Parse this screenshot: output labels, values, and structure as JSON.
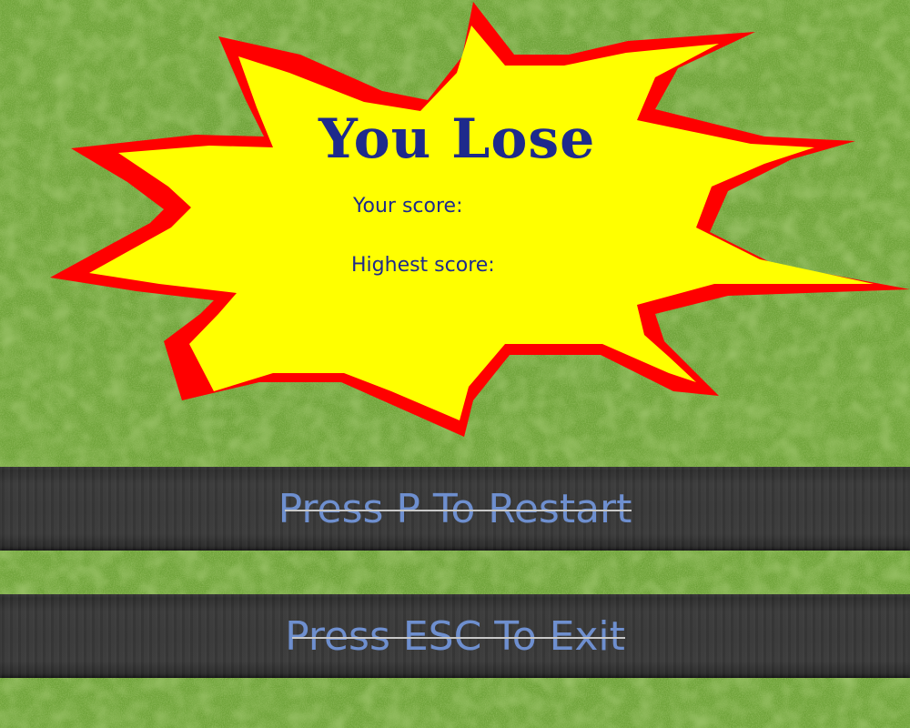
{
  "screen": {
    "title": "You Lose",
    "your_score_label": "Your score:",
    "highest_score_label": "Highest score:"
  },
  "actions": {
    "restart_label": "Press P To Restart",
    "exit_label": "Press ESC To Exit"
  },
  "colors": {
    "grass": "#6fa33a",
    "burst_fill": "#ffff00",
    "burst_outline": "#ff0000",
    "title_text": "#1e2a8c",
    "bar_text": "#6e8fcf"
  }
}
